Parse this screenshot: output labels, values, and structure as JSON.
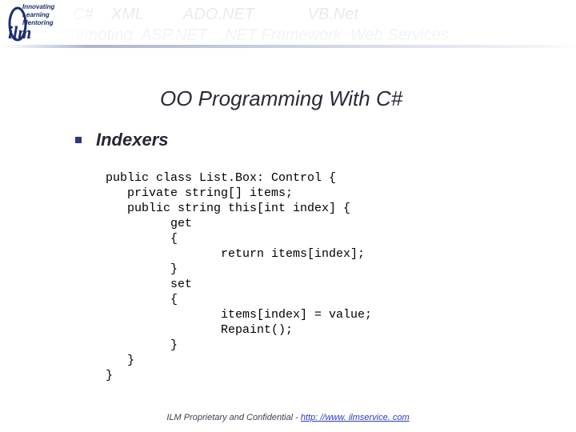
{
  "banner": {
    "ghost_line1": "  C#    XML         ADO.NET            VB.Net",
    "ghost_line2": "Remoting  ASP.NET   .NET Framework  Web Services"
  },
  "logo": {
    "alt": "ILM Logo",
    "tagline_l1": "Innovating",
    "tagline_l2": "Learning",
    "tagline_l3": "Mentoring"
  },
  "title": "OO Programming With C#",
  "bullet": {
    "label": "Indexers"
  },
  "code": "public class List.Box: Control {\n   private string[] items;\n   public string this[int index] {\n         get\n         {\n                return items[index];\n         }\n         set\n         {\n                items[index] = value;\n                Repaint();\n         }\n   }\n}",
  "footer": {
    "text": "ILM Proprietary and Confidential - ",
    "link_label": "http: //www. ilmservice. com",
    "link_href": "http://www.ilmservice.com"
  }
}
